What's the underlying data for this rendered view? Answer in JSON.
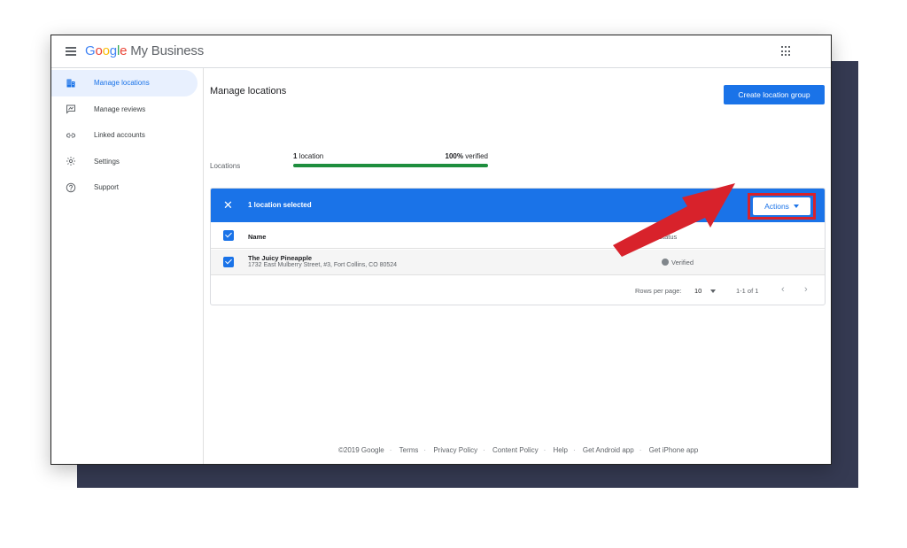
{
  "app": {
    "logo_google": [
      "G",
      "o",
      "o",
      "g",
      "l",
      "e"
    ],
    "logo_rest": " My Business"
  },
  "sidebar": {
    "items": [
      {
        "label": "Manage locations",
        "icon": "building-icon",
        "active": true
      },
      {
        "label": "Manage reviews",
        "icon": "reviews-icon",
        "active": false
      },
      {
        "label": "Linked accounts",
        "icon": "link-icon",
        "active": false
      },
      {
        "label": "Settings",
        "icon": "gear-icon",
        "active": false
      },
      {
        "label": "Support",
        "icon": "help-icon",
        "active": false
      }
    ]
  },
  "main": {
    "title": "Manage locations",
    "create_button": "Create location group",
    "locations_label": "Locations",
    "count_num": "1",
    "count_text": " location",
    "verified_num": "100%",
    "verified_text": " verified",
    "verified_fraction": 1.0
  },
  "table": {
    "selection_text": "1 location selected",
    "actions_label": "Actions",
    "col_name": "Name",
    "col_status": "Status",
    "rows": [
      {
        "name": "The Juicy Pineapple",
        "address": "1732 East Mulberry Street, #3, Fort Collins, CO 80524",
        "status": "Verified"
      }
    ],
    "rows_per_page_label": "Rows per page:",
    "rows_per_page_value": "10",
    "range": "1-1 of 1"
  },
  "footer": {
    "copyright": "©2019 Google",
    "links": [
      "Terms",
      "Privacy Policy",
      "Content Policy",
      "Help",
      "Get Android app",
      "Get iPhone app"
    ]
  },
  "colors": {
    "accent": "#1a73e8",
    "highlight": "#d8222b",
    "progress": "#1e8e3e",
    "backdrop": "#353a52"
  }
}
